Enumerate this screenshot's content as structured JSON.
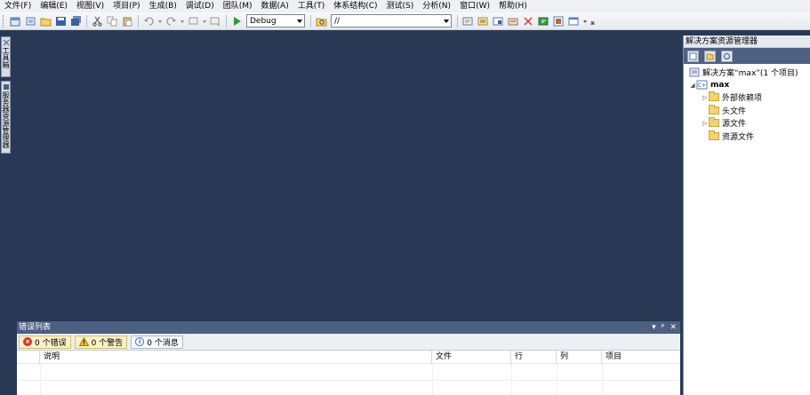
{
  "menu": [
    "文件(F)",
    "编辑(E)",
    "视图(V)",
    "项目(P)",
    "生成(B)",
    "调试(D)",
    "团队(M)",
    "数据(A)",
    "工具(T)",
    "体系结构(C)",
    "测试(S)",
    "分析(N)",
    "窗口(W)",
    "帮助(H)"
  ],
  "toolbar": {
    "config_combo": "Debug",
    "find_combo": "//"
  },
  "left_dock": {
    "toolbox": "工具箱",
    "server_explorer": "服务器资源管理器"
  },
  "solution_explorer": {
    "title": "解决方案资源管理器",
    "solution": "解决方案“max”(1 个项目)",
    "project": "max",
    "items": [
      "外部依赖项",
      "头文件",
      "源文件",
      "资源文件"
    ]
  },
  "error_list": {
    "title": "错误列表",
    "errors": "0 个错误",
    "warnings": "0 个警告",
    "messages": "0 个消息",
    "columns": [
      "说明",
      "文件",
      "行",
      "列",
      "项目"
    ],
    "controls": [
      "▾",
      "ᵖ",
      "✕"
    ]
  },
  "colors": {
    "workspace": "#293955",
    "panel_header": "#4d6082",
    "accent_play": "#2a9d3b"
  }
}
